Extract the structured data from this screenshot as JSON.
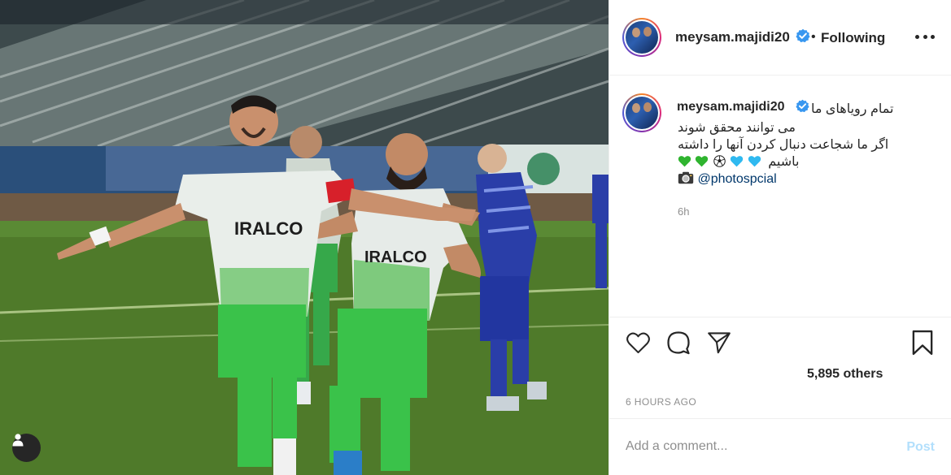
{
  "post": {
    "photo": {
      "alt_icon": "user-tag-icon",
      "jersey_text_1": "IRALCO",
      "jersey_text_2": "IRALCO"
    }
  },
  "header": {
    "username": "meysam.majidi20",
    "verified_icon": "verified-badge-icon",
    "separator": "•",
    "follow_status": "Following",
    "more_icon": "more-options-icon"
  },
  "caption": {
    "username": "meysam.majidi20",
    "lines": [
      "تمام رویاهای ما",
      "می توانند محقق شوند",
      "اگر ما شجاعت دنبال کردن آنها را داشته",
      "باشیم",
      "@photospcial"
    ],
    "emoji_row": [
      "blue-heart",
      "blue-heart",
      "soccer-ball",
      "green-heart",
      "green-heart"
    ],
    "camera_icon": "camera-icon",
    "time_ago": "6h"
  },
  "actions": {
    "like_icon": "heart-icon",
    "comment_icon": "comment-icon",
    "share_icon": "share-icon",
    "save_icon": "bookmark-icon",
    "likes_text": "5,895 others",
    "timestamp": "6 HOURS AGO"
  },
  "comment_box": {
    "placeholder": "Add a comment...",
    "post_label": "Post"
  },
  "colors": {
    "verified_blue": "#3897f0",
    "post_button_disabled": "#b2dffc",
    "muted_text": "#8e8e8e",
    "link_text": "#00376b",
    "border": "#efefef"
  }
}
